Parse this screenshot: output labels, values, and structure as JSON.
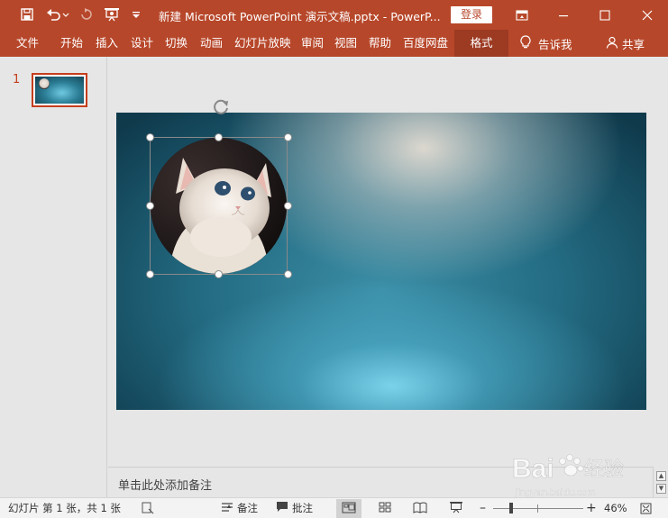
{
  "window": {
    "title": "新建 Microsoft PowerPoint 演示文稿.pptx  -  PowerP...",
    "login_label": "登录"
  },
  "ribbon": {
    "tabs": [
      {
        "label": "文件"
      },
      {
        "label": "开始"
      },
      {
        "label": "插入"
      },
      {
        "label": "设计"
      },
      {
        "label": "切换"
      },
      {
        "label": "动画"
      },
      {
        "label": "幻灯片放映"
      },
      {
        "label": "审阅"
      },
      {
        "label": "视图"
      },
      {
        "label": "帮助"
      },
      {
        "label": "百度网盘"
      },
      {
        "label": "格式"
      }
    ],
    "tell_me": "告诉我",
    "share": "共享"
  },
  "thumbnails": {
    "items": [
      {
        "number": "1"
      }
    ]
  },
  "notes": {
    "placeholder": "单击此处添加备注"
  },
  "status": {
    "slide_info": "幻灯片 第 1 张，共 1 张",
    "notes_label": "备注",
    "comments_label": "批注",
    "zoom_minus": "–",
    "zoom_plus": "+",
    "zoom_level": "46%"
  },
  "watermark": {
    "brand": "Bai",
    "brand_suffix": "经验",
    "url": "jingyan.baidu.com"
  },
  "colors": {
    "accent": "#b7472a",
    "accent_dark": "#9c3a22",
    "thumb_border": "#c43e1c"
  }
}
